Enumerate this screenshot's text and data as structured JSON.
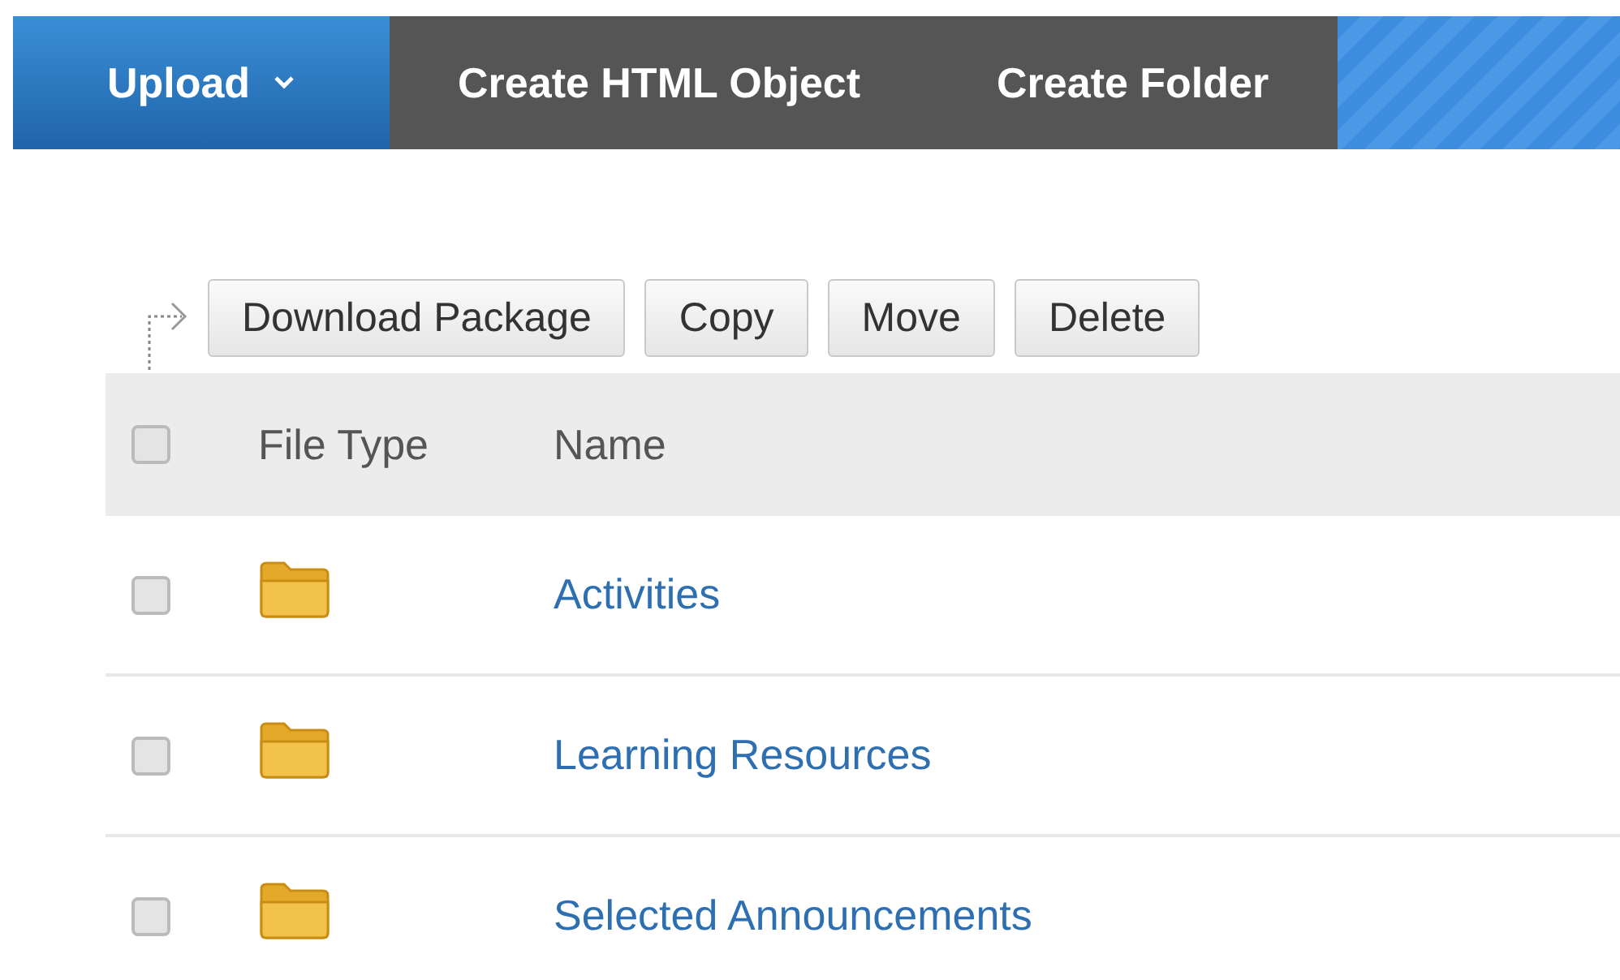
{
  "toolbar": {
    "items": [
      {
        "label": "Upload",
        "kind": "dropdown"
      },
      {
        "label": "Create HTML Object",
        "kind": "plain"
      },
      {
        "label": "Create Folder",
        "kind": "plain"
      }
    ]
  },
  "actions": [
    "Download Package",
    "Copy",
    "Move",
    "Delete"
  ],
  "table": {
    "select_all": {
      "checked": false
    },
    "columns": [
      "File Type",
      "Name"
    ],
    "rows": [
      {
        "checked": false,
        "name": "Activities"
      },
      {
        "checked": false,
        "name": "Learning Resources"
      },
      {
        "checked": false,
        "name": "Selected Announcements"
      }
    ]
  }
}
